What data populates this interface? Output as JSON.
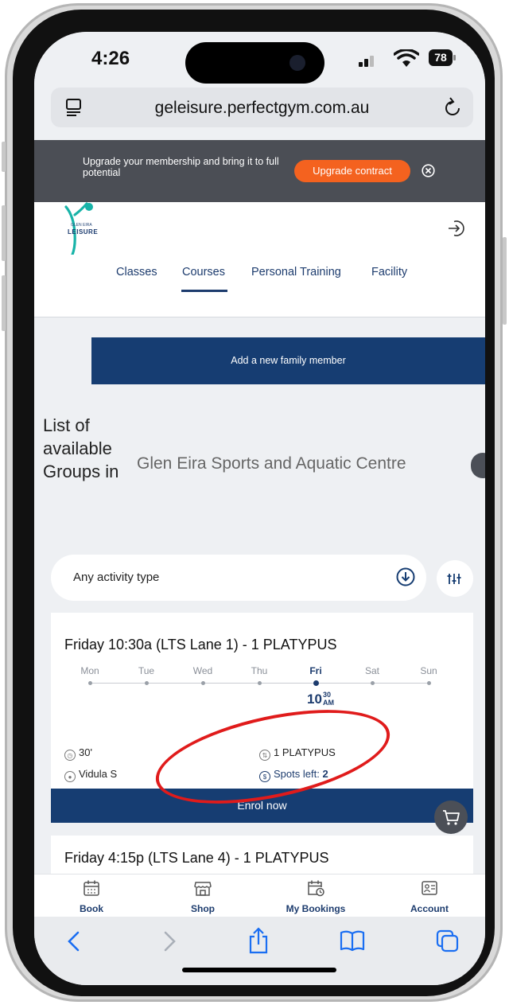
{
  "status_bar": {
    "time": "4:26",
    "battery": "78"
  },
  "browser": {
    "url": "geleisure.perfectgym.com.au"
  },
  "promo": {
    "text": "Upgrade your membership and bring it to full potential",
    "button": "Upgrade contract"
  },
  "logo": {
    "line1": "GLEN EIRA",
    "line2": "LEISURE"
  },
  "tabs": [
    "Classes",
    "Courses",
    "Personal Training",
    "Facility"
  ],
  "active_tab": "Courses",
  "family_button": "Add a new family member",
  "groups": {
    "title": "List of available Groups in",
    "location": "Glen Eira Sports and Aquatic Centre"
  },
  "filter": {
    "label": "Any activity type"
  },
  "weekdays": [
    "Mon",
    "Tue",
    "Wed",
    "Thu",
    "Fri",
    "Sat",
    "Sun"
  ],
  "classes": [
    {
      "title": "Friday 10:30a (LTS Lane 1) - 1 PLATYPUS",
      "active_day": "Fri",
      "time_hour": "10",
      "time_min": "30",
      "time_ampm": "AM",
      "duration": "30'",
      "level": "1 PLATYPUS",
      "instructor": "Vidula S",
      "spots_label": "Spots left:",
      "spots_value": "2",
      "enrol_label": "Enrol now"
    },
    {
      "title": "Friday 4:15p (LTS Lane 4) - 1 PLATYPUS",
      "active_day": "Fri"
    }
  ],
  "bottom_nav": [
    {
      "label": "Book",
      "icon": "calendar-icon"
    },
    {
      "label": "Shop",
      "icon": "shop-icon"
    },
    {
      "label": "My Bookings",
      "icon": "bookings-icon"
    },
    {
      "label": "Account",
      "icon": "account-icon"
    }
  ],
  "colors": {
    "primary": "#163d72",
    "accent": "#f4621f",
    "promo_bg": "#4b4e55",
    "highlight": "#e01b1b"
  }
}
